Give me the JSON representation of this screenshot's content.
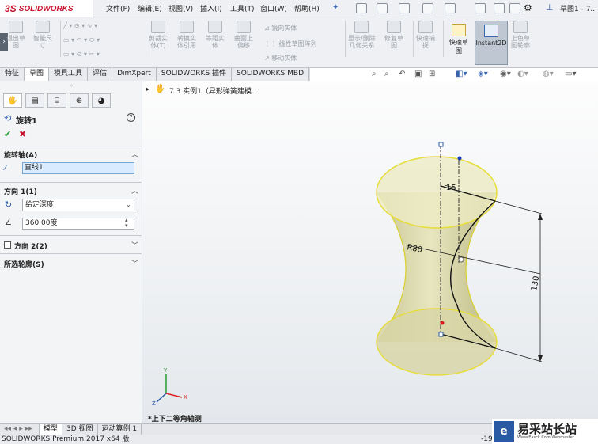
{
  "app": {
    "logo_text": "SOLIDWORKS",
    "logo_prefix": "3S",
    "doc_title": "草图1 - 7..."
  },
  "menu": [
    "文件(F)",
    "编辑(E)",
    "视图(V)",
    "插入(I)",
    "工具(T)",
    "窗口(W)",
    "帮助(H)"
  ],
  "ribbon": {
    "exit_sketch": "退出草\n图",
    "smart_dim": "智能尺\n寸",
    "trim": "剪裁实\n体(T)",
    "convert": "转换实\n体引用",
    "offset": "等距实\n体",
    "surface": "曲面上\n偏移",
    "mirror": "镜向实体",
    "linear_pattern": "线性草图阵列",
    "move": "移动实体",
    "show_delete": "显示/删除\n几何关系",
    "repair": "修复草\n图",
    "quick_snap": "快速捕\n捉",
    "quick_sketch": "快速草\n图",
    "instant2d": "Instant2D",
    "shaded_sketch": "上色草\n图轮廓"
  },
  "tabs": [
    "特征",
    "草图",
    "模具工具",
    "评估",
    "DimXpert",
    "SOLIDWORKS 插件",
    "SOLIDWORKS MBD"
  ],
  "active_tab": "草图",
  "tree_item": "7.3 实例1（异形弹簧建模...",
  "panel": {
    "title": "旋转1",
    "axis_section": "旋转轴(A)",
    "axis_value": "直线1",
    "dir1_section": "方向 1(1)",
    "dir1_type": "给定深度",
    "angle": "360.00度",
    "dir2_section": "方向 2(2)",
    "contours_section": "所选轮廓(S)"
  },
  "drawing": {
    "dim_15": "15",
    "dim_r80": "R80",
    "dim_130": "130"
  },
  "view_label": "*上下二等角轴测",
  "bottom_tabs": [
    "模型",
    "3D 视图",
    "运动算例 1"
  ],
  "status": "SOLIDWORKS Premium 2017 x64 版",
  "status_right": "-19",
  "watermark": {
    "title": "易采站长站",
    "sub": "Www.Easck.Com Webmaster"
  },
  "colors": {
    "accent": "#c8102e",
    "shape_fill": "#d8d6a8",
    "shape_edge": "#e6dd3a"
  }
}
